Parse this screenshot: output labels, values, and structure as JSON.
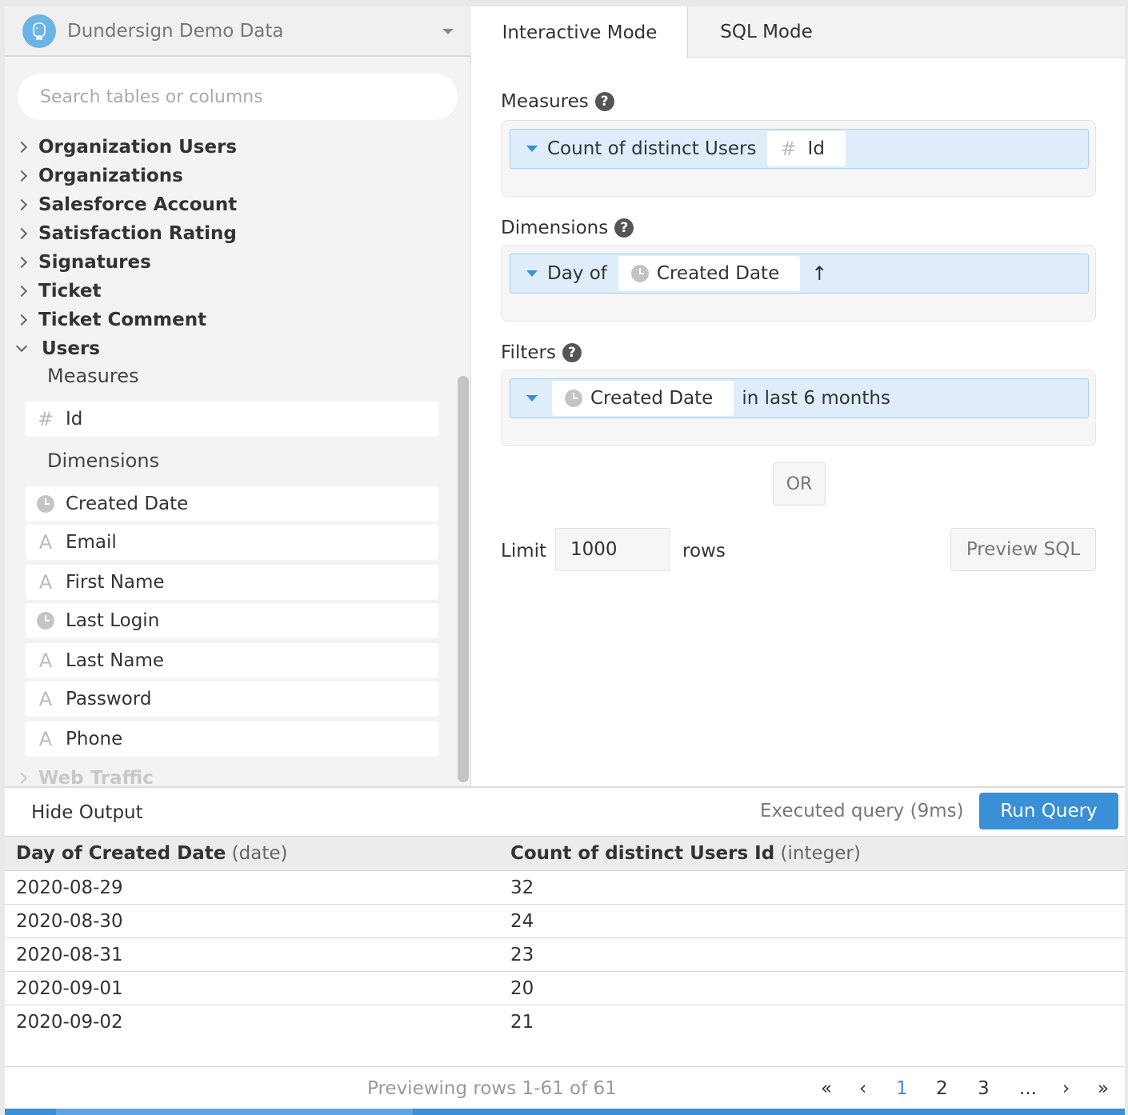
{
  "datasource": {
    "name": "Dundersign Demo Data",
    "logo_icon": "elephant-icon"
  },
  "search": {
    "placeholder": "Search tables or columns"
  },
  "tables": [
    "Organization Users",
    "Organizations",
    "Salesforce Account",
    "Satisfaction Rating",
    "Signatures",
    "Ticket",
    "Ticket Comment"
  ],
  "expanded_table": {
    "name": "Users",
    "measures_label": "Measures",
    "measures": [
      {
        "name": "Id",
        "type": "number"
      }
    ],
    "dimensions_label": "Dimensions",
    "dimensions": [
      {
        "name": "Created Date",
        "type": "date"
      },
      {
        "name": "Email",
        "type": "text"
      },
      {
        "name": "First Name",
        "type": "text"
      },
      {
        "name": "Last Login",
        "type": "date"
      },
      {
        "name": "Last Name",
        "type": "text"
      },
      {
        "name": "Password",
        "type": "text"
      },
      {
        "name": "Phone",
        "type": "text"
      }
    ]
  },
  "next_table": "Web Traffic",
  "tabs": [
    {
      "label": "Interactive Mode",
      "active": true
    },
    {
      "label": "SQL Mode",
      "active": false
    }
  ],
  "query": {
    "measures_title": "Measures",
    "measure": {
      "agg": "Count of distinct Users",
      "field": "Id"
    },
    "dimensions_title": "Dimensions",
    "dimension": {
      "granularity": "Day of",
      "field": "Created Date",
      "sort": "↑"
    },
    "filters_title": "Filters",
    "filter": {
      "field": "Created Date",
      "condition": "in last 6 months"
    },
    "or_label": "OR",
    "limit_label": "Limit",
    "limit_value": "1000",
    "rows_label": "rows",
    "preview_sql": "Preview SQL",
    "help_glyph": "?"
  },
  "output": {
    "hide_label": "Hide Output",
    "status": "Executed query (9ms)",
    "run_label": "Run Query",
    "columns": [
      {
        "name": "Day of Created Date",
        "type": "(date)"
      },
      {
        "name": "Count of distinct Users Id",
        "type": "(integer)"
      }
    ],
    "rows": [
      [
        "2020-08-29",
        "32"
      ],
      [
        "2020-08-30",
        "24"
      ],
      [
        "2020-08-31",
        "23"
      ],
      [
        "2020-09-01",
        "20"
      ],
      [
        "2020-09-02",
        "21"
      ]
    ],
    "preview_text": "Previewing rows 1-61 of 61",
    "pagination": {
      "first": "«",
      "prev": "‹",
      "pages": [
        "1",
        "2",
        "3"
      ],
      "current": "1",
      "ellipsis": "...",
      "next": "›",
      "last": "»"
    }
  },
  "colors": {
    "accent": "#3a8fd6",
    "pill_bg": "#deedf9",
    "pill_border": "#a9d0ef"
  }
}
